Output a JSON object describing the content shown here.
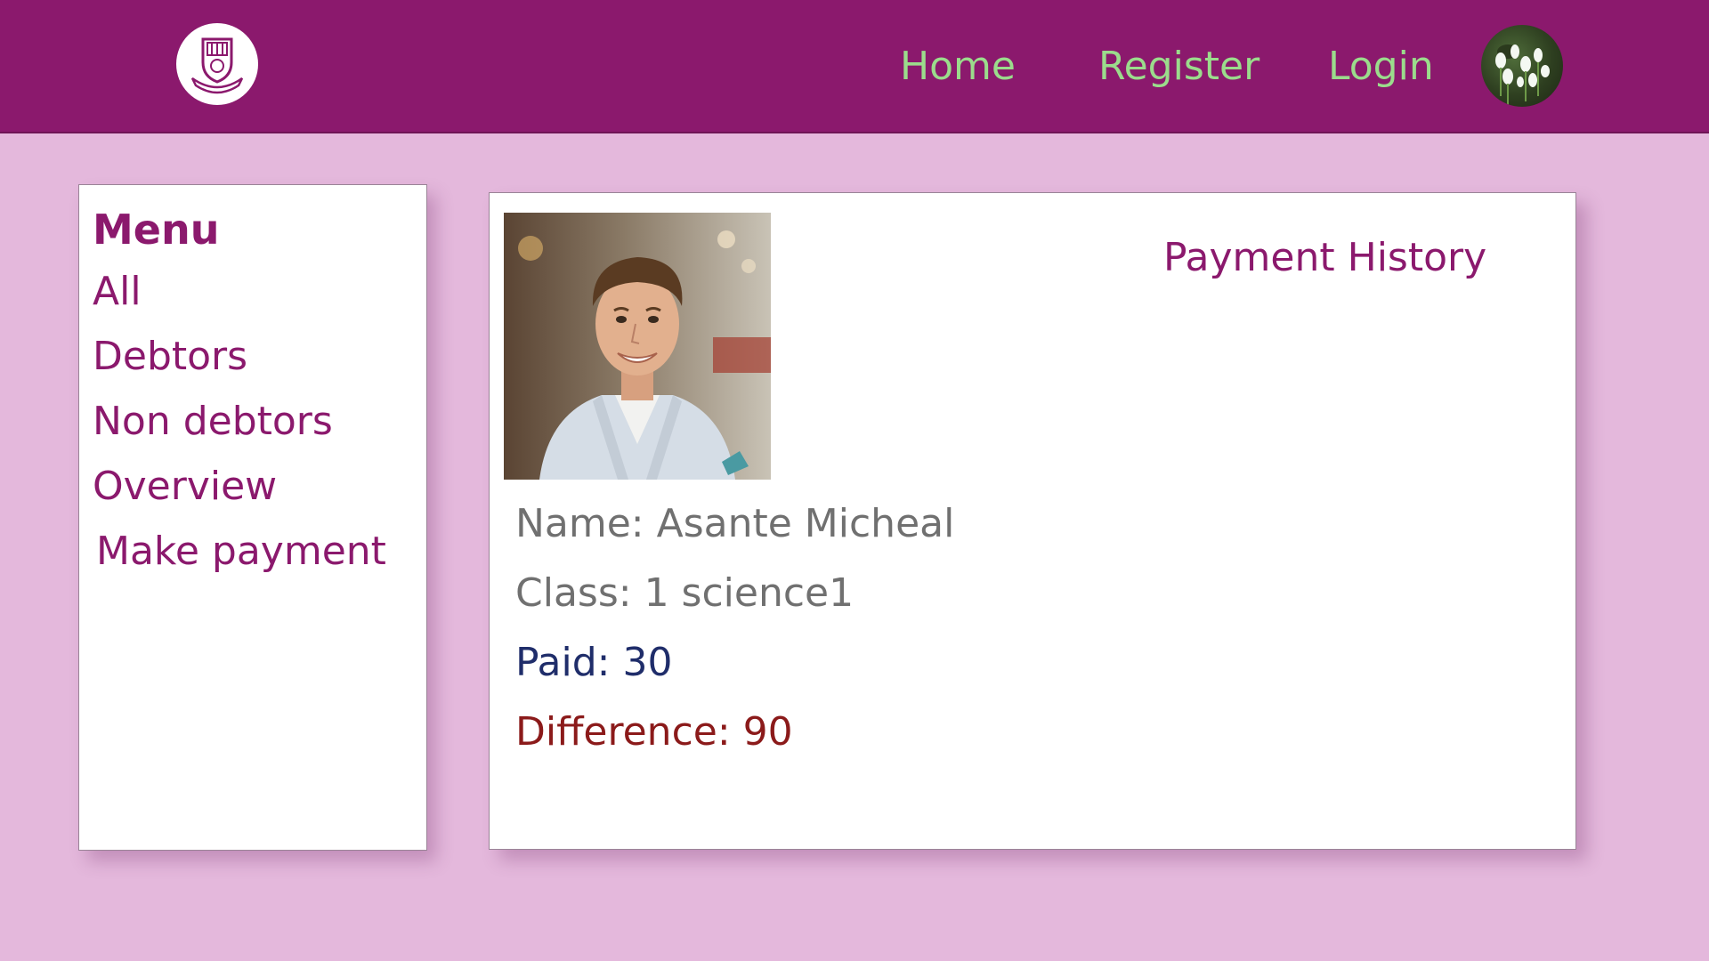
{
  "header": {
    "logo_icon": "school-crest-icon",
    "nav": {
      "home": "Home",
      "register": "Register",
      "login": "Login"
    },
    "avatar_icon": "user-avatar-icon"
  },
  "sidebar": {
    "title": "Menu",
    "items": [
      {
        "label": "All"
      },
      {
        "label": "Debtors"
      },
      {
        "label": "Non debtors"
      },
      {
        "label": "Overview"
      },
      {
        "label": "Make payment"
      }
    ]
  },
  "main": {
    "title": "Payment History",
    "student": {
      "name": "Name: Asante Micheal",
      "class": "Class: 1 science1",
      "paid": "Paid: 30",
      "difference": "Difference: 90"
    }
  },
  "colors": {
    "header_bg": "#8b196d",
    "page_bg": "#e4b8dc",
    "nav_link": "#9bdc8c",
    "accent_text": "#8b196d",
    "muted_text": "#707070",
    "paid_text": "#1f2d6a",
    "difference_text": "#8b1a1a"
  }
}
